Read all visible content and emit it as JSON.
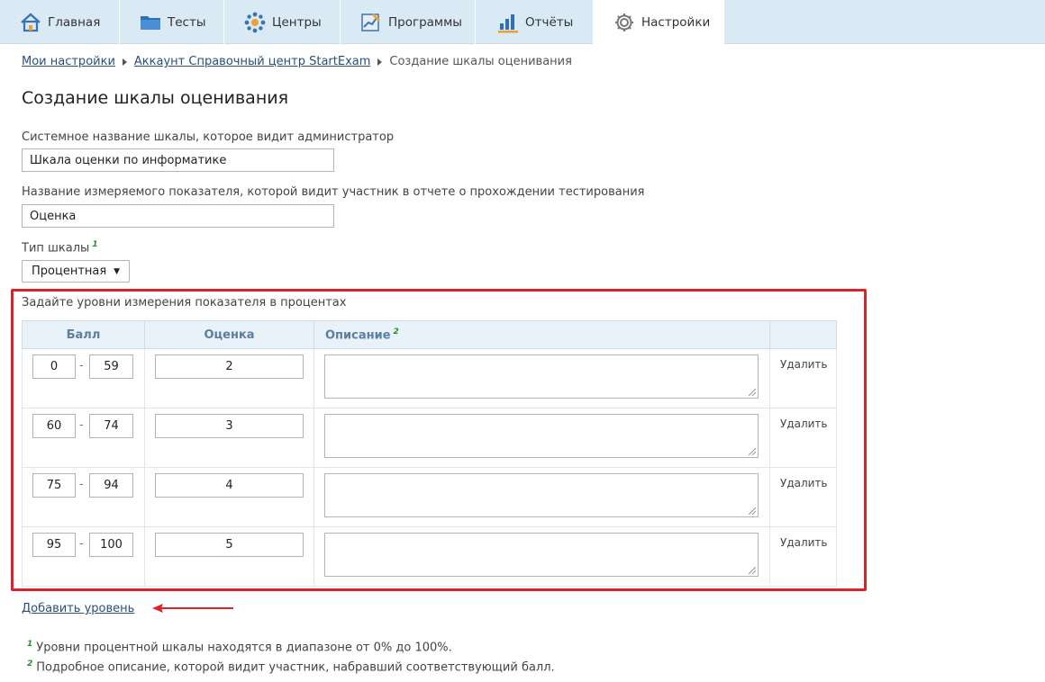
{
  "nav": {
    "tabs": [
      {
        "label": "Главная",
        "icon": "home-icon"
      },
      {
        "label": "Тесты",
        "icon": "folder-icon"
      },
      {
        "label": "Центры",
        "icon": "network-icon"
      },
      {
        "label": "Программы",
        "icon": "chart-pen-icon"
      },
      {
        "label": "Отчёты",
        "icon": "bar-chart-icon"
      },
      {
        "label": "Настройки",
        "icon": "gear-icon"
      }
    ],
    "active": "Настройки"
  },
  "breadcrumb": {
    "items": [
      "Мои настройки",
      "Аккаунт Справочный центр StartExam"
    ],
    "current": "Создание шкалы оценивания"
  },
  "page_title": "Создание шкалы оценивания",
  "form": {
    "system_name_label": "Системное название шкалы, которое видит администратор",
    "system_name_value": "Шкала оценки по информатике",
    "indicator_label": "Название измеряемого показателя, которой видит участник в отчете о прохождении тестирования",
    "indicator_value": "Оценка",
    "scale_type_label": "Тип шкалы",
    "scale_type_note": "1",
    "scale_type_value": "Процентная"
  },
  "levels": {
    "title": "Задайте уровни измерения показателя в процентах",
    "headers": {
      "score": "Балл",
      "grade": "Оценка",
      "description": "Описание",
      "description_note": "2"
    },
    "rows": [
      {
        "from": "0",
        "to": "59",
        "grade": "2",
        "description": "",
        "delete": "Удалить"
      },
      {
        "from": "60",
        "to": "74",
        "grade": "3",
        "description": "",
        "delete": "Удалить"
      },
      {
        "from": "75",
        "to": "94",
        "grade": "4",
        "description": "",
        "delete": "Удалить"
      },
      {
        "from": "95",
        "to": "100",
        "grade": "5",
        "description": "",
        "delete": "Удалить"
      }
    ],
    "range_separator": "-",
    "add_label": "Добавить уровень"
  },
  "notes": [
    {
      "mark": "1",
      "text": "Уровни процентной шкалы находятся в диапазоне от 0% до 100%."
    },
    {
      "mark": "2",
      "text": "Подробное описание, которой видит участник, набравший соответствующий балл."
    }
  ],
  "colors": {
    "nav_bg": "#d9eaf4",
    "highlight": "#d9232b",
    "link": "#2b4f7a",
    "table_header_text": "#5b7fa0",
    "note_mark": "#2a8a2a"
  }
}
